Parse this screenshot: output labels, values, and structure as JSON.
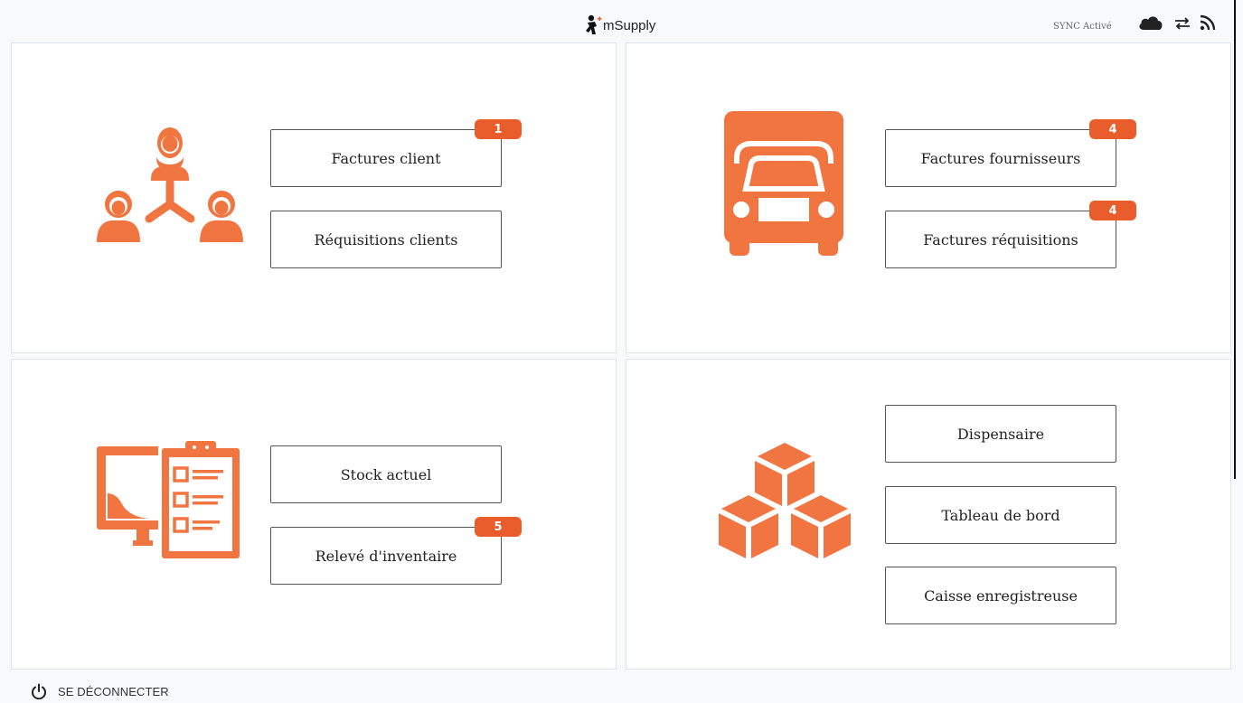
{
  "header": {
    "app_name": "mSupply",
    "sync_status": "SYNC Activé"
  },
  "panels": {
    "customers": {
      "illustration": "customers-network-icon",
      "buttons": [
        {
          "label": "Factures client",
          "badge": "1"
        },
        {
          "label": "Réquisitions clients",
          "badge": ""
        }
      ]
    },
    "suppliers": {
      "illustration": "truck-icon",
      "buttons": [
        {
          "label": "Factures fournisseurs",
          "badge": "4"
        },
        {
          "label": "Factures réquisitions",
          "badge": "4"
        }
      ]
    },
    "stock": {
      "illustration": "monitor-clipboard-icon",
      "buttons": [
        {
          "label": "Stock actuel",
          "badge": ""
        },
        {
          "label": "Relevé d'inventaire",
          "badge": "5"
        }
      ]
    },
    "modules": {
      "illustration": "boxes-icon",
      "buttons": [
        {
          "label": "Dispensaire"
        },
        {
          "label": "Tableau de bord"
        },
        {
          "label": "Caisse enregistreuse"
        }
      ]
    }
  },
  "footer": {
    "logout_label": "SE DÉCONNECTER"
  },
  "colors": {
    "accent": "#f07540",
    "badge": "#e95c2b",
    "panel_bg": "#ffffff",
    "page_bg": "#f7f9fb"
  }
}
